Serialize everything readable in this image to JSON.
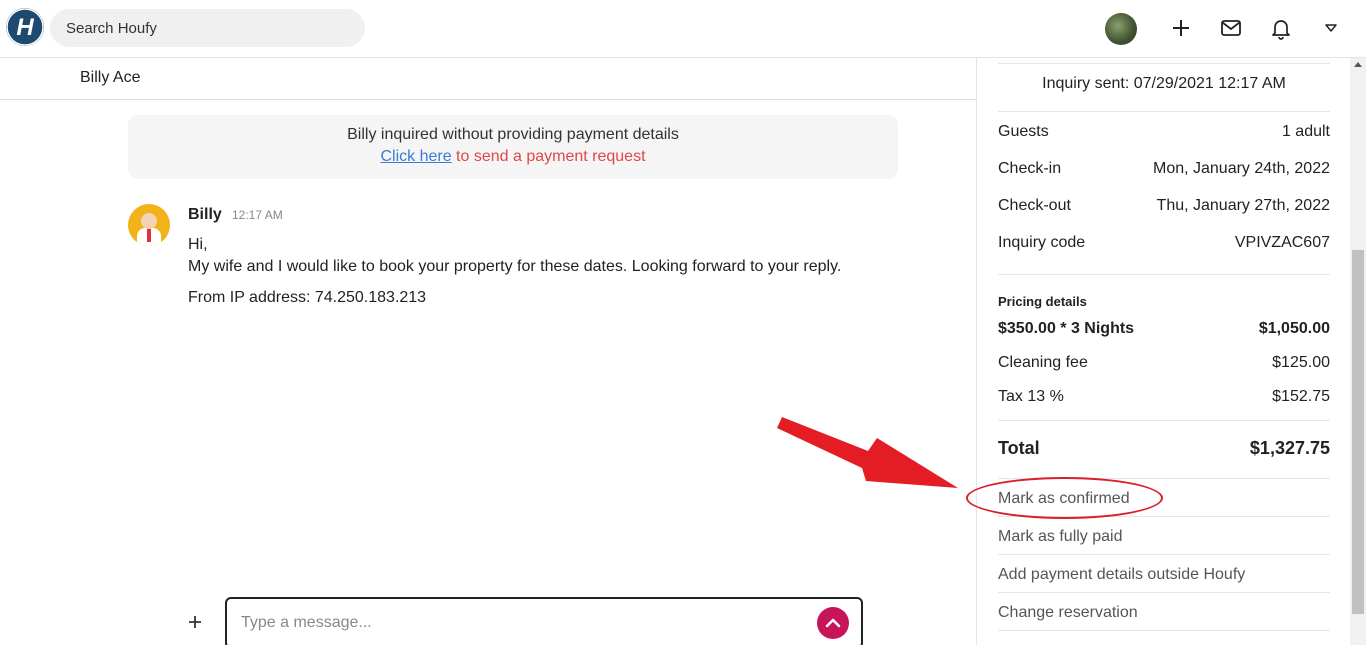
{
  "topbar": {
    "logo_letter": "H",
    "search_placeholder": "Search Houfy",
    "icons": [
      "avatar",
      "plus-icon",
      "mail-icon",
      "bell-icon",
      "caret-down-icon"
    ]
  },
  "conversation": {
    "contact_name": "Billy Ace",
    "notice": {
      "line1": "Billy inquired without providing payment details",
      "link": "Click here",
      "link_suffix": " to send a payment request"
    },
    "message": {
      "sender": "Billy",
      "time": "12:17 AM",
      "line1": "Hi,",
      "line2": "My wife and I would like to book your property for these dates. Looking forward to your reply.",
      "ip": "From IP address: 74.250.183.213"
    },
    "composer_placeholder": "Type a message..."
  },
  "panel": {
    "inquiry_sent": "Inquiry sent: 07/29/2021 12:17 AM",
    "details": [
      {
        "label": "Guests",
        "value": "1 adult"
      },
      {
        "label": "Check-in",
        "value": "Mon, January 24th, 2022"
      },
      {
        "label": "Check-out",
        "value": "Thu, January 27th, 2022"
      },
      {
        "label": "Inquiry code",
        "value": "VPIVZAC607"
      }
    ],
    "pricing_label": "Pricing details",
    "pricing": [
      {
        "label": "$350.00 * 3 Nights",
        "value": "$1,050.00"
      },
      {
        "label": "Cleaning fee",
        "value": "$125.00"
      },
      {
        "label": "Tax 13 %",
        "value": "$152.75"
      }
    ],
    "total": {
      "label": "Total",
      "value": "$1,327.75"
    },
    "actions": [
      "Mark as confirmed",
      "Mark as fully paid",
      "Add payment details outside Houfy",
      "Change reservation"
    ]
  },
  "colors": {
    "brand": "#1d4a6e",
    "send_button": "#c8155a",
    "link": "#3a7bd5",
    "notice_red": "#e04848",
    "annotation_red": "#d81f2a"
  }
}
